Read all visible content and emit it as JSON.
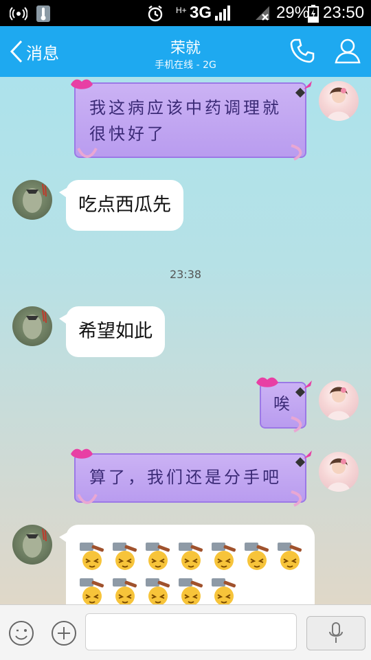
{
  "status_bar": {
    "battery": "29%",
    "time": "23:50",
    "network": "3G",
    "network_hplus": "H+"
  },
  "header": {
    "back_label": "消息",
    "title": "荣就",
    "subtitle": "手机在线 - 2G"
  },
  "messages": [
    {
      "from": "me",
      "lines": [
        "我这病应该中药调理就",
        "很快好了"
      ]
    },
    {
      "from": "other",
      "text": "吃点西瓜先"
    },
    {
      "from": "other",
      "text": "希望如此"
    },
    {
      "from": "me",
      "lines": [
        "唉"
      ]
    },
    {
      "from": "me",
      "lines": [
        "算了，我们还是分手吧"
      ]
    },
    {
      "from": "other",
      "emoji": "hammer-emoji"
    }
  ],
  "timestamp": "23:38",
  "input": {
    "value": ""
  },
  "colors": {
    "header": "#1ea9f0",
    "bubble_purple": "#b99cef",
    "bubble_white": "#ffffff"
  }
}
